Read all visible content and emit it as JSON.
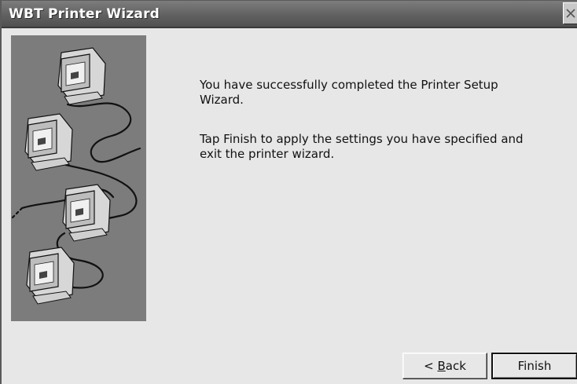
{
  "window": {
    "title": "WBT Printer Wizard",
    "close_icon": "close-icon"
  },
  "content": {
    "line1": "You have successfully completed the Printer Setup Wizard.",
    "line2": "Tap Finish to apply the settings you have specified and exit the printer wizard."
  },
  "buttons": {
    "back_prefix": "< ",
    "back_accel": "B",
    "back_rest": "ack",
    "finish": "Finish"
  },
  "illustration": {
    "icon": "networked-computers-icon",
    "computer_count": 4,
    "background_color": "#7c7c7c"
  }
}
